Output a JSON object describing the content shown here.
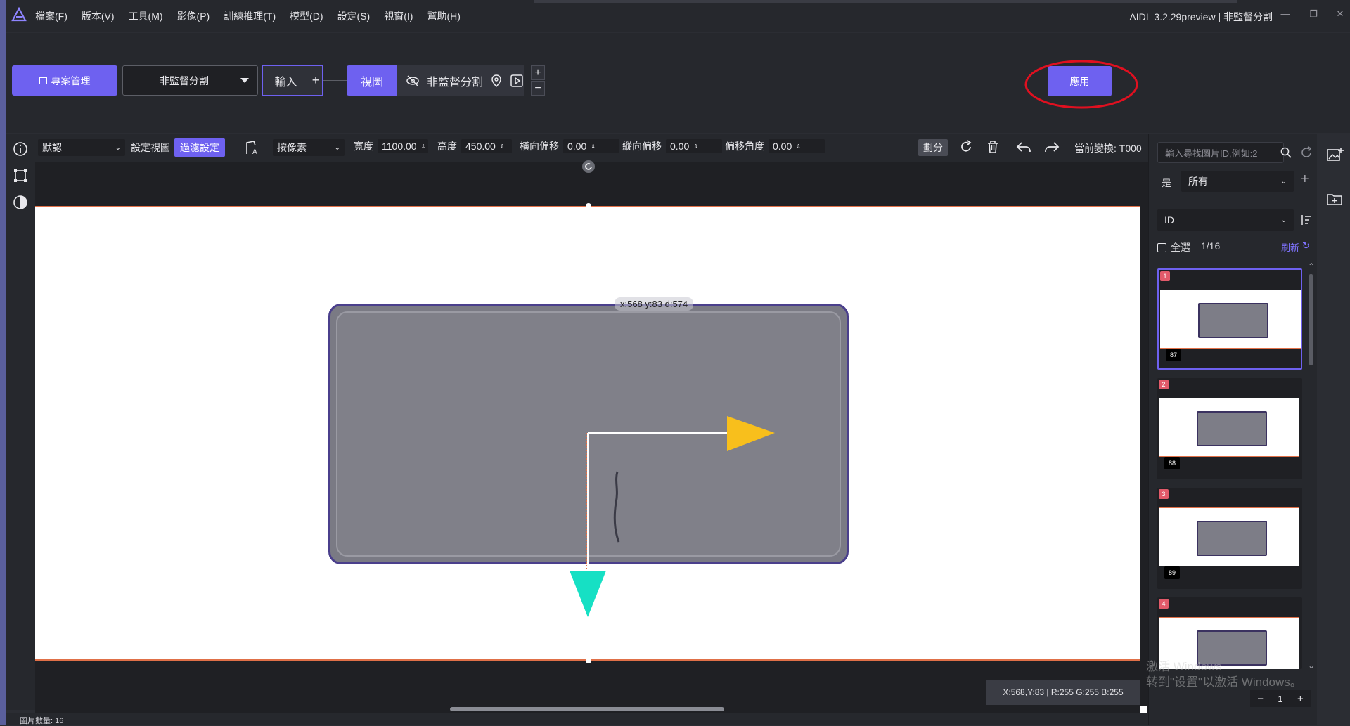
{
  "menu": {
    "items": [
      "檔案(F)",
      "版本(V)",
      "工具(M)",
      "影像(P)",
      "訓練推理(T)",
      "模型(D)",
      "設定(S)",
      "視窗(I)",
      "幫助(H)"
    ]
  },
  "app_title": "AIDI_3.2.29preview | 非監督分割",
  "topbar": {
    "project_btn": "專案管理",
    "mode_select": "非監督分割",
    "input_btn": "輸入",
    "view_btn": "視圖",
    "module_label": "非監督分割",
    "apply_btn": "應用"
  },
  "toolbar": {
    "preset": "默認",
    "set_view": "設定視圖",
    "filter_settings": "過濾設定",
    "unit": "按像素",
    "width_label": "寬度",
    "width_value": "1100.00",
    "height_label": "高度",
    "height_value": "450.00",
    "hoffset_label": "橫向偏移",
    "hoffset_value": "0.00",
    "voffset_label": "縱向偏移",
    "voffset_value": "0.00",
    "angle_label": "偏移角度",
    "angle_value": "0.00",
    "split_btn": "劃分",
    "current_transform": "當前變換: T000"
  },
  "canvas": {
    "coord_tip": "x:568 y:83 d:574",
    "status": "X:568,Y:83 | R:255 G:255 B:255"
  },
  "right_panel": {
    "search_placeholder": "輸入尋找圖片ID,例如:2",
    "filter_prefix": "是",
    "filter_value": "所有",
    "sort_value": "ID",
    "select_all": "全選",
    "count": "1/16",
    "refresh": "刷新",
    "thumbnails": [
      {
        "index": "1",
        "id": "87"
      },
      {
        "index": "2",
        "id": "88"
      },
      {
        "index": "3",
        "id": "89"
      },
      {
        "index": "4",
        "id": ""
      }
    ],
    "page_value": "1"
  },
  "watermark": {
    "line1": "激活 Windows",
    "line2": "转到\"设置\"以激活 Windows。"
  },
  "bottom": {
    "image_count": "圖片數量:  16"
  },
  "colors": {
    "accent": "#6e61f0",
    "highlight_circle": "#e01020",
    "arrow_x": "#f8bf1c",
    "arrow_y": "#16e0c4",
    "border_orange": "#e07048"
  }
}
